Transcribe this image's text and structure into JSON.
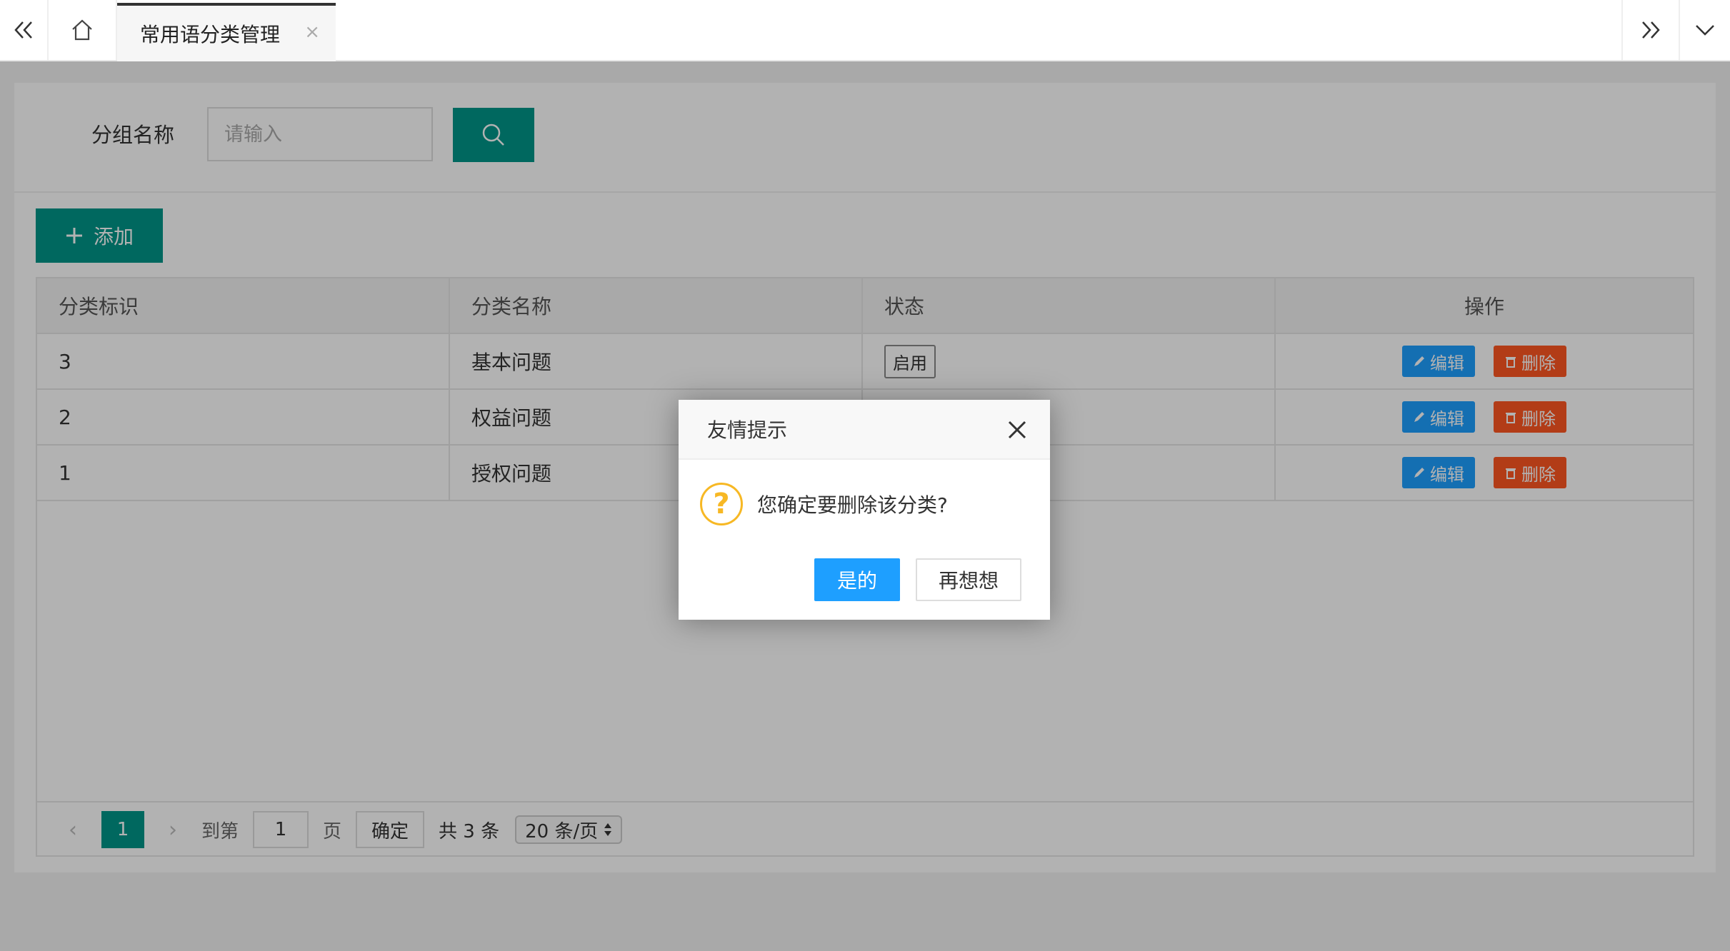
{
  "tabs": {
    "active_label": "常用语分类管理",
    "close_glyph": "×",
    "left_icon": "double-chevron-left-icon",
    "home_icon": "home-icon",
    "right_icon": "double-chevron-right-icon",
    "dropdown_icon": "chevron-down-icon"
  },
  "search": {
    "label": "分组名称",
    "placeholder": "请输入",
    "button_icon": "search-icon"
  },
  "toolbar": {
    "add_label": "添加",
    "add_icon": "plus-icon"
  },
  "table": {
    "headers": [
      "分类标识",
      "分类名称",
      "状态",
      "操作"
    ],
    "rows": [
      {
        "id": "3",
        "name": "基本问题",
        "status": "启用"
      },
      {
        "id": "2",
        "name": "权益问题",
        "status": ""
      },
      {
        "id": "1",
        "name": "授权问题",
        "status": ""
      }
    ],
    "edit_label": "编辑",
    "delete_label": "删除"
  },
  "pager": {
    "current_page": "1",
    "goto_label": "到第",
    "goto_value": "1",
    "page_unit": "页",
    "confirm_label": "确定",
    "total_text": "共 3 条",
    "page_size": "20 条/页"
  },
  "dialog": {
    "title": "友情提示",
    "message": "您确定要删除该分类?",
    "question_glyph": "?",
    "yes_label": "是的",
    "no_label": "再想想"
  },
  "colors": {
    "primary": "#009688",
    "edit": "#1e9fff",
    "delete": "#ff5722",
    "warning": "#f7b824"
  }
}
